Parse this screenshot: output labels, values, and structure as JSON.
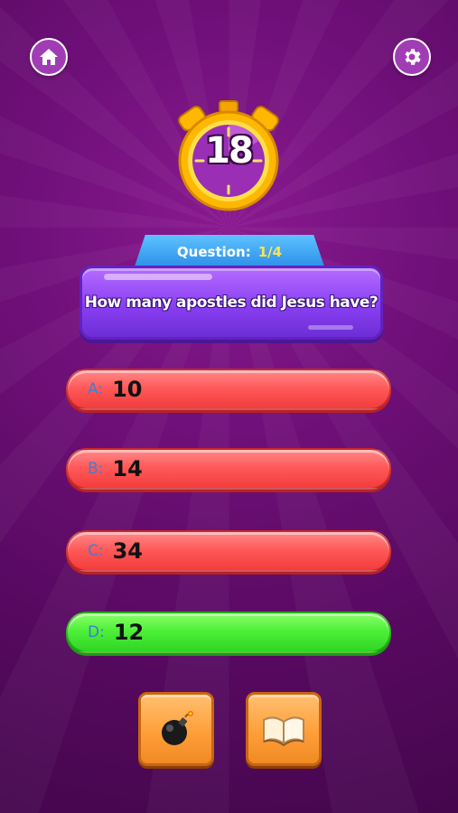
{
  "timer": {
    "seconds": "18"
  },
  "question": {
    "label": "Question:",
    "counter": "1/4",
    "text": "How many apostles did Jesus have?"
  },
  "answers": [
    {
      "letter": "A:",
      "value": "10",
      "state": "default"
    },
    {
      "letter": "B:",
      "value": "14",
      "state": "default"
    },
    {
      "letter": "C:",
      "value": "34",
      "state": "default"
    },
    {
      "letter": "D:",
      "value": "12",
      "state": "correct"
    }
  ],
  "icons": {
    "home": "home-icon",
    "settings": "gear-icon",
    "bomb_powerup": "bomb-icon",
    "book_powerup": "book-icon"
  },
  "colors": {
    "background": "#6e0f78",
    "answer_default": "#ff5a5a",
    "answer_correct": "#4ef03a",
    "question_box": "#8a3ff2",
    "timer_ring": "#ffb400",
    "powerup": "#ff9f3a"
  }
}
